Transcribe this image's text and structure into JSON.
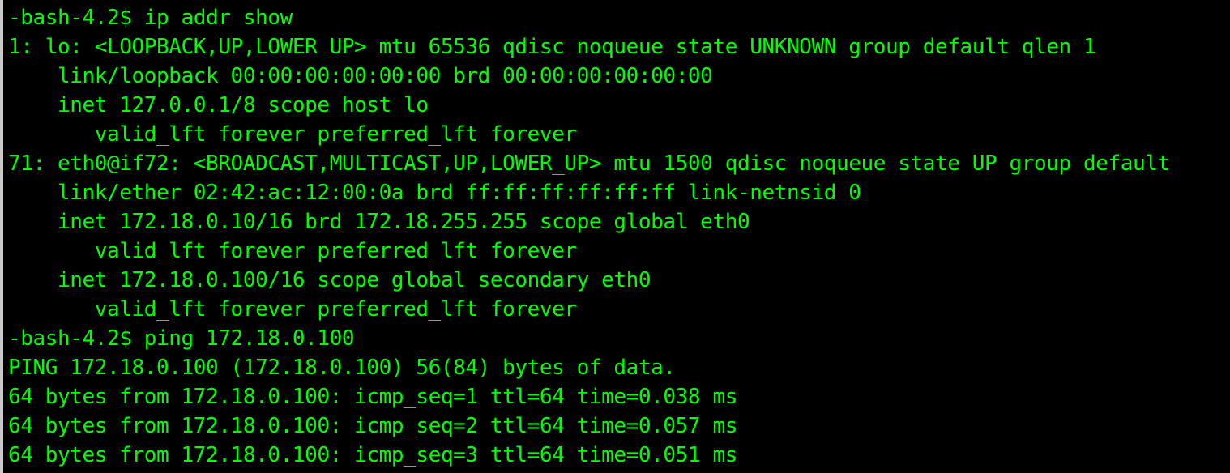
{
  "colors": {
    "background": "#000000",
    "foreground": "#00ff00",
    "border": "#c8c8c8"
  },
  "terminal": {
    "lines": [
      "-bash-4.2$ ip addr show",
      "1: lo: <LOOPBACK,UP,LOWER_UP> mtu 65536 qdisc noqueue state UNKNOWN group default qlen 1",
      "    link/loopback 00:00:00:00:00:00 brd 00:00:00:00:00:00",
      "    inet 127.0.0.1/8 scope host lo",
      "       valid_lft forever preferred_lft forever",
      "71: eth0@if72: <BROADCAST,MULTICAST,UP,LOWER_UP> mtu 1500 qdisc noqueue state UP group default",
      "    link/ether 02:42:ac:12:00:0a brd ff:ff:ff:ff:ff:ff link-netnsid 0",
      "    inet 172.18.0.10/16 brd 172.18.255.255 scope global eth0",
      "       valid_lft forever preferred_lft forever",
      "    inet 172.18.0.100/16 scope global secondary eth0",
      "       valid_lft forever preferred_lft forever",
      "-bash-4.2$ ping 172.18.0.100",
      "PING 172.18.0.100 (172.18.0.100) 56(84) bytes of data.",
      "64 bytes from 172.18.0.100: icmp_seq=1 ttl=64 time=0.038 ms",
      "64 bytes from 172.18.0.100: icmp_seq=2 ttl=64 time=0.057 ms",
      "64 bytes from 172.18.0.100: icmp_seq=3 ttl=64 time=0.051 ms"
    ]
  }
}
